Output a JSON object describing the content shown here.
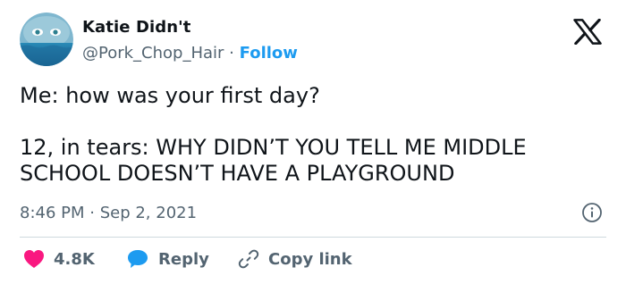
{
  "author": {
    "display_name": "Katie Didn't",
    "handle": "@Pork_Chop_Hair",
    "separator": "·",
    "follow_label": "Follow"
  },
  "tweet": {
    "line1": "Me: how was your first day?",
    "line2": "12, in tears: WHY DIDN’T YOU TELL ME MIDDLE",
    "line3": "SCHOOL DOESN’T HAVE A PLAYGROUND",
    "timestamp": "8:46 PM · Sep 2, 2021"
  },
  "actions": {
    "likes_label": "4.8K",
    "reply_label": "Reply",
    "copy_link_label": "Copy link"
  },
  "icons": {
    "logo": "x-logo-icon",
    "info": "info-icon",
    "like": "heart-icon",
    "reply": "speech-bubble-icon",
    "copy": "link-icon"
  },
  "colors": {
    "text": "#0f1419",
    "secondary": "#536471",
    "accent": "#1d9bf0",
    "like": "#f91880",
    "divider": "#cfd9de"
  }
}
